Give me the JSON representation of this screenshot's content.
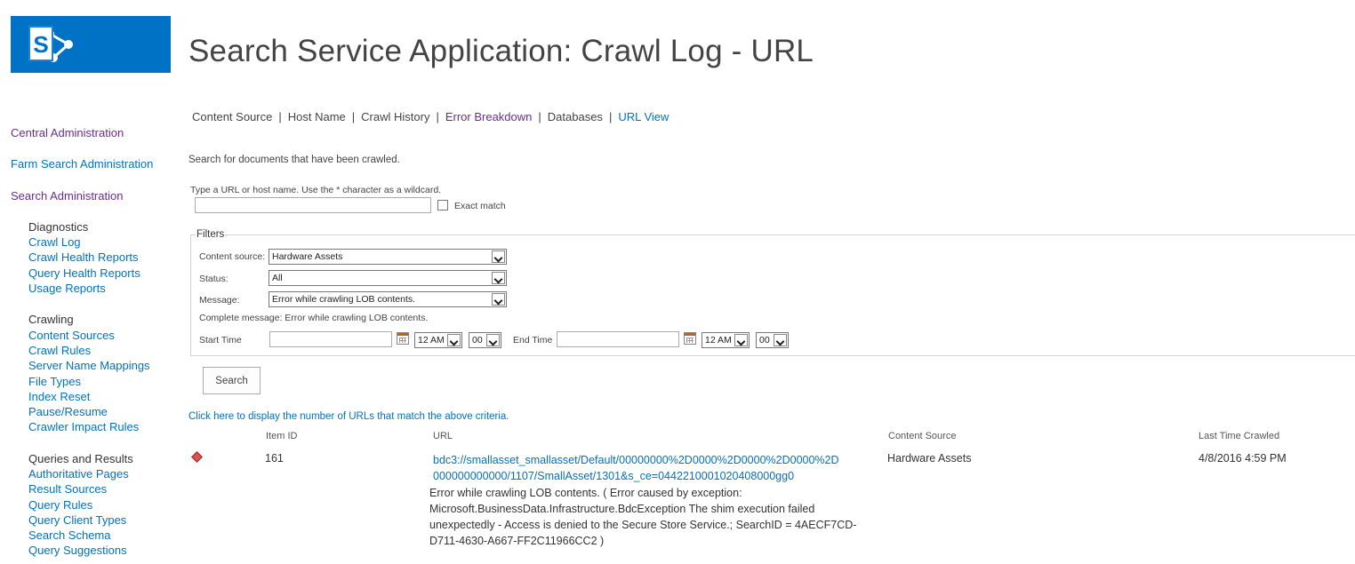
{
  "header": {
    "title": "Search Service Application: Crawl Log - URL",
    "brand_color": "#0072c6"
  },
  "topnav": {
    "items": [
      {
        "label": "Content Source"
      },
      {
        "label": "Host Name"
      },
      {
        "label": "Crawl History"
      },
      {
        "label": "Error Breakdown"
      },
      {
        "label": "Databases"
      },
      {
        "label": "URL View"
      }
    ],
    "separator": "|"
  },
  "sidebar": {
    "top_links": [
      {
        "label": "Central Administration"
      },
      {
        "label": "Farm Search Administration"
      },
      {
        "label": "Search Administration"
      }
    ],
    "groups": [
      {
        "title": "Diagnostics",
        "items": [
          "Crawl Log",
          "Crawl Health Reports",
          "Query Health Reports",
          "Usage Reports"
        ]
      },
      {
        "title": "Crawling",
        "items": [
          "Content Sources",
          "Crawl Rules",
          "Server Name Mappings",
          "File Types",
          "Index Reset",
          "Pause/Resume",
          "Crawler Impact Rules"
        ]
      },
      {
        "title": "Queries and Results",
        "items": [
          "Authoritative Pages",
          "Result Sources",
          "Query Rules",
          "Query Client Types",
          "Search Schema",
          "Query Suggestions"
        ]
      }
    ]
  },
  "search": {
    "description": "Search for documents that have been crawled.",
    "hint": "Type a URL or host name. Use the * character as a wildcard.",
    "url_value": "",
    "exact_match_label": "Exact match",
    "exact_match_checked": false
  },
  "filters": {
    "legend": "Filters",
    "content_source_label": "Content source:",
    "content_source_value": "Hardware Assets",
    "status_label": "Status:",
    "status_value": "All",
    "message_label": "Message:",
    "message_value": "Error while crawling LOB contents.",
    "complete_message": "Complete message: Error while crawling LOB contents.",
    "start_time_label": "Start Time",
    "end_time_label": "End Time",
    "start_hour": "12 AM",
    "start_minute": "00",
    "end_hour": "12 AM",
    "end_minute": "00"
  },
  "search_button": "Search",
  "count_link": "Click here to display the number of URLs that match the above criteria.",
  "results": {
    "columns": {
      "item_id": "Item ID",
      "url": "URL",
      "content_source": "Content Source",
      "last_crawled": "Last Time Crawled"
    },
    "rows": [
      {
        "status": "error",
        "item_id": "161",
        "url": "bdc3://smallasset_smallasset/Default/00000000%2D0000%2D0000%2D0000%2D000000000000/1107/SmallAsset/1301&s_ce=0442210001020408000gg0",
        "content_source": "Hardware Assets",
        "last_crawled": "4/8/2016 4:59 PM",
        "message": "Error while crawling LOB contents. ( Error caused by exception: Microsoft.BusinessData.Infrastructure.BdcException The shim execution failed unexpectedly - Access is denied to the Secure Store Service.; SearchID = 4AECF7CD-D711-4630-A667-FF2C11966CC2 )"
      }
    ]
  }
}
